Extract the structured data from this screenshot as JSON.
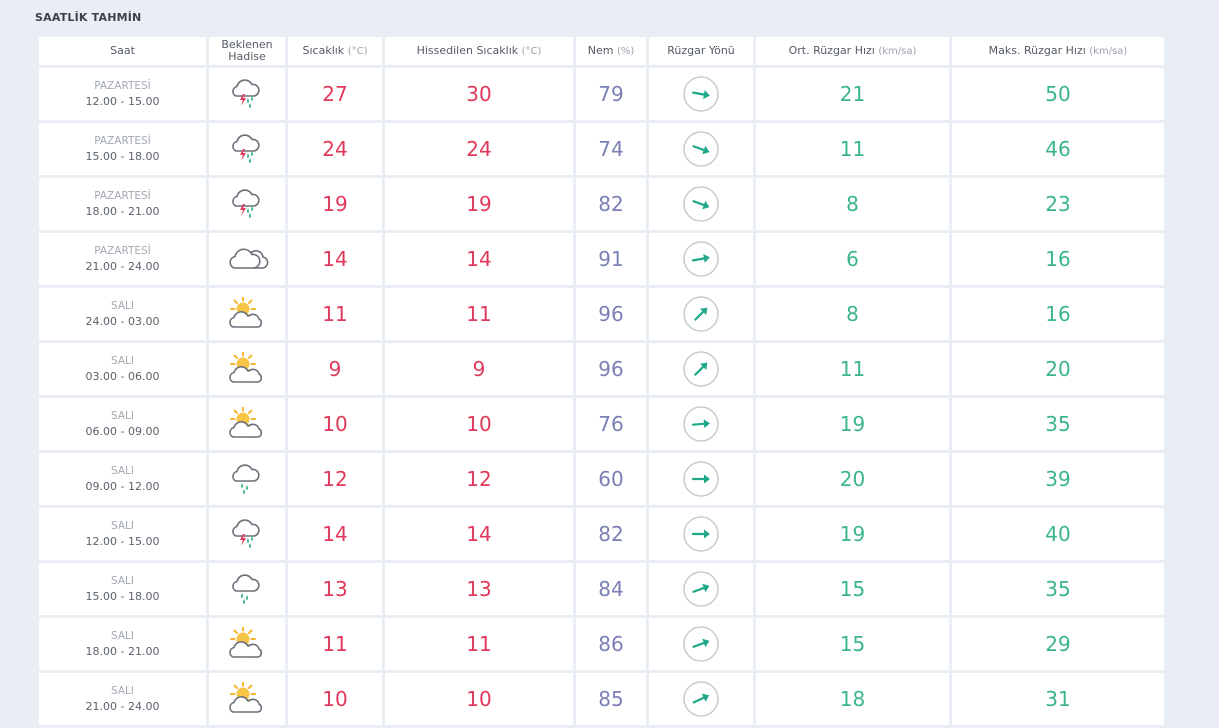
{
  "page": {
    "title": "SAATLİK TAHMİN"
  },
  "headers": {
    "saat": "Saat",
    "hadise_1": "Beklenen",
    "hadise_2": "Hadise",
    "sicaklik": "Sıcaklık",
    "sicaklik_unit": "(°C)",
    "hissedilen": "Hissedilen Sıcaklık",
    "hissedilen_unit": "(°C)",
    "nem": "Nem",
    "nem_unit": "(%)",
    "yon": "Rüzgar Yönü",
    "ort": "Ort. Rüzgar Hızı",
    "ort_unit": "(km/sa)",
    "maks": "Maks. Rüzgar Hızı",
    "maks_unit": "(km/sa)"
  },
  "colors": {
    "temp": "#e0395a",
    "humidity": "#7a7fb5",
    "wind": "#3bb58a",
    "background": "#e9edf4"
  },
  "rows": [
    {
      "day": "PAZARTESİ",
      "range": "12.00 - 15.00",
      "icon": "thunderstorm-rain-icon",
      "temp": "27",
      "feels": "30",
      "humidity": "79",
      "wind_dir_deg": 100,
      "wind_avg": "21",
      "wind_max": "50"
    },
    {
      "day": "PAZARTESİ",
      "range": "15.00 - 18.00",
      "icon": "thunderstorm-rain-icon",
      "temp": "24",
      "feels": "24",
      "humidity": "74",
      "wind_dir_deg": 110,
      "wind_avg": "11",
      "wind_max": "46"
    },
    {
      "day": "PAZARTESİ",
      "range": "18.00 - 21.00",
      "icon": "thunderstorm-rain-icon",
      "temp": "19",
      "feels": "19",
      "humidity": "82",
      "wind_dir_deg": 110,
      "wind_avg": "8",
      "wind_max": "23"
    },
    {
      "day": "PAZARTESİ",
      "range": "21.00 - 24.00",
      "icon": "cloudy-icon",
      "temp": "14",
      "feels": "14",
      "humidity": "91",
      "wind_dir_deg": 80,
      "wind_avg": "6",
      "wind_max": "16"
    },
    {
      "day": "SALI",
      "range": "24.00 - 03.00",
      "icon": "partly-cloudy-icon",
      "temp": "11",
      "feels": "11",
      "humidity": "96",
      "wind_dir_deg": 45,
      "wind_avg": "8",
      "wind_max": "16"
    },
    {
      "day": "SALI",
      "range": "03.00 - 06.00",
      "icon": "partly-cloudy-icon",
      "temp": "9",
      "feels": "9",
      "humidity": "96",
      "wind_dir_deg": 45,
      "wind_avg": "11",
      "wind_max": "20"
    },
    {
      "day": "SALI",
      "range": "06.00 - 09.00",
      "icon": "partly-cloudy-icon",
      "temp": "10",
      "feels": "10",
      "humidity": "76",
      "wind_dir_deg": 85,
      "wind_avg": "19",
      "wind_max": "35"
    },
    {
      "day": "SALI",
      "range": "09.00 - 12.00",
      "icon": "rain-icon",
      "temp": "12",
      "feels": "12",
      "humidity": "60",
      "wind_dir_deg": 90,
      "wind_avg": "20",
      "wind_max": "39"
    },
    {
      "day": "SALI",
      "range": "12.00 - 15.00",
      "icon": "thunderstorm-rain-icon",
      "temp": "14",
      "feels": "14",
      "humidity": "82",
      "wind_dir_deg": 90,
      "wind_avg": "19",
      "wind_max": "40"
    },
    {
      "day": "SALI",
      "range": "15.00 - 18.00",
      "icon": "rain-icon",
      "temp": "13",
      "feels": "13",
      "humidity": "84",
      "wind_dir_deg": 70,
      "wind_avg": "15",
      "wind_max": "35"
    },
    {
      "day": "SALI",
      "range": "18.00 - 21.00",
      "icon": "partly-cloudy-icon",
      "temp": "11",
      "feels": "11",
      "humidity": "86",
      "wind_dir_deg": 70,
      "wind_avg": "15",
      "wind_max": "29"
    },
    {
      "day": "SALI",
      "range": "21.00 - 24.00",
      "icon": "partly-cloudy-icon",
      "temp": "10",
      "feels": "10",
      "humidity": "85",
      "wind_dir_deg": 65,
      "wind_avg": "18",
      "wind_max": "31"
    }
  ]
}
